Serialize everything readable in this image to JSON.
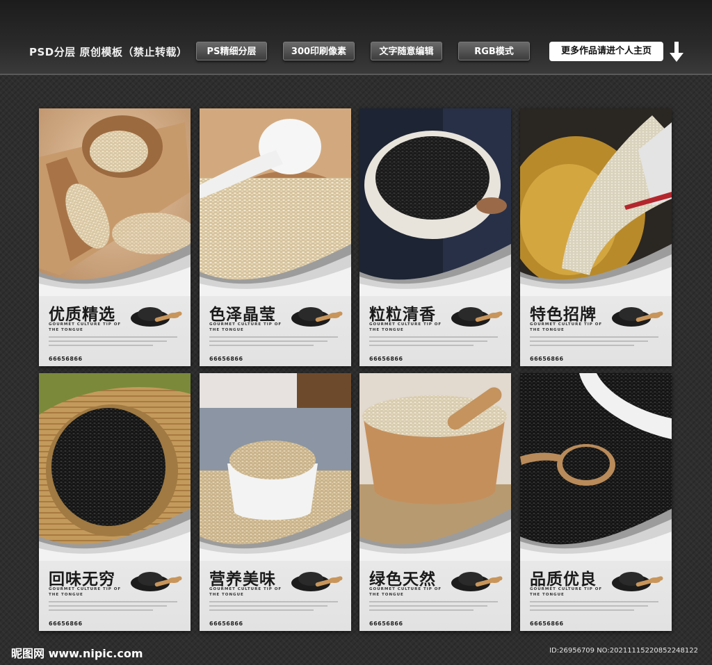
{
  "header": {
    "title": "PSD分层 原创模板（禁止转载）",
    "tags": [
      "PS精细分层",
      "300印刷像素",
      "文字随意编辑",
      "RGB模式"
    ],
    "cta_label": "更多作品请进个人主页"
  },
  "posters": [
    {
      "title": "优质精选",
      "subtitle": "GOURMET CULTURE TIP OF THE TONGUE",
      "phone": "66656866",
      "photo": "sesame-white-wooden-scoop"
    },
    {
      "title": "色泽晶莹",
      "subtitle": "GOURMET CULTURE TIP OF THE TONGUE",
      "phone": "66656866",
      "photo": "sesame-white-spoon"
    },
    {
      "title": "粒粒清香",
      "subtitle": "GOURMET CULTURE TIP OF THE TONGUE",
      "phone": "66656866",
      "photo": "sesame-black-bowl"
    },
    {
      "title": "特色招牌",
      "subtitle": "GOURMET CULTURE TIP OF THE TONGUE",
      "phone": "66656866",
      "photo": "sesame-white-pouring"
    },
    {
      "title": "回味无穷",
      "subtitle": "GOURMET CULTURE TIP OF THE TONGUE",
      "phone": "66656866",
      "photo": "sesame-black-basket"
    },
    {
      "title": "营养美味",
      "subtitle": "GOURMET CULTURE TIP OF THE TONGUE",
      "phone": "66656866",
      "photo": "sesame-white-ceramic-bowl"
    },
    {
      "title": "绿色天然",
      "subtitle": "GOURMET CULTURE TIP OF THE TONGUE",
      "phone": "66656866",
      "photo": "sesame-white-mortar"
    },
    {
      "title": "品质优良",
      "subtitle": "GOURMET CULTURE TIP OF THE TONGUE",
      "phone": "66656866",
      "photo": "sesame-black-spoon"
    }
  ],
  "footer": {
    "logo": "昵图网 www.nipic.com",
    "id_text": "ID:26956709 NO:20211115220852248122"
  },
  "colors": {
    "background": "#2e2e2e",
    "poster_background": "#ececec",
    "title_text": "#1a1a1a"
  }
}
